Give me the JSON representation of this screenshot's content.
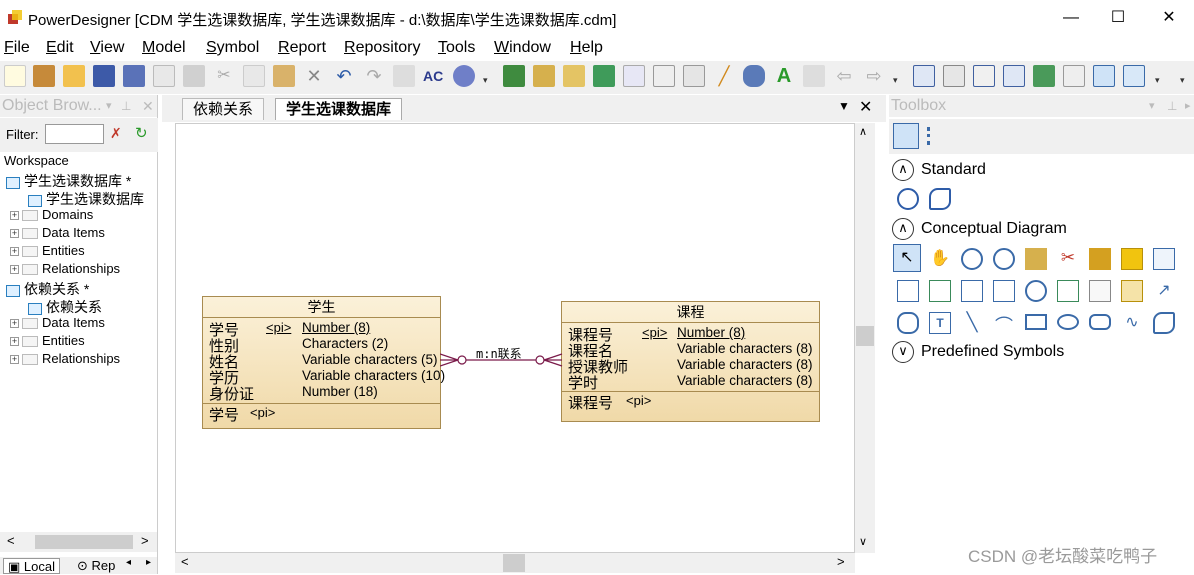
{
  "window": {
    "title": "PowerDesigner [CDM 学生选课数据库, 学生选课数据库 - d:\\数据库\\学生选课数据库.cdm]",
    "minimize": "—",
    "maximize": "☐",
    "close": "✕"
  },
  "menu": [
    {
      "key": "F",
      "rest": "ile"
    },
    {
      "key": "E",
      "rest": "dit"
    },
    {
      "key": "V",
      "rest": "iew"
    },
    {
      "key": "M",
      "rest": "odel"
    },
    {
      "key": "S",
      "rest": "ymbol"
    },
    {
      "key": "R",
      "rest": "eport"
    },
    {
      "key": "R",
      "rest": "epository"
    },
    {
      "key": "T",
      "rest": "ools"
    },
    {
      "key": "W",
      "rest": "indow"
    },
    {
      "key": "H",
      "rest": "elp"
    }
  ],
  "object_browser": {
    "title": "Object Brow...",
    "filter_label": "Filter:",
    "filter_value": "",
    "tree": {
      "root": "Workspace",
      "model1": "学生选课数据库 *",
      "model1_diagram": "学生选课数据库",
      "model1_domains": "Domains",
      "model1_data_items": "Data Items",
      "model1_entities": "Entities",
      "model1_relationships": "Relationships",
      "model2": "依赖关系 *",
      "model2_diagram": "依赖关系",
      "model2_data_items": "Data Items",
      "model2_entities": "Entities",
      "model2_relationships": "Relationships"
    },
    "bottom_tabs": [
      "Local",
      "Rep"
    ]
  },
  "diagram_tabs": [
    "依赖关系",
    "学生选课数据库"
  ],
  "diagram": {
    "entity_student": {
      "name": "学生",
      "attrs": [
        {
          "name": "学号",
          "pi": "<pi>",
          "type": "Number (8)"
        },
        {
          "name": "性别",
          "pi": "",
          "type": "Characters (2)"
        },
        {
          "name": "姓名",
          "pi": "",
          "type": "Variable characters (5)"
        },
        {
          "name": "学历",
          "pi": "",
          "type": "Variable characters (10)"
        },
        {
          "name": "身份证",
          "pi": "",
          "type": "Number (18)"
        }
      ],
      "identifier": {
        "name": "学号",
        "pi": "<pi>"
      }
    },
    "entity_course": {
      "name": "课程",
      "attrs": [
        {
          "name": "课程号",
          "pi": "<pi>",
          "type": "Number (8)"
        },
        {
          "name": "课程名",
          "pi": "",
          "type": "Variable characters (8)"
        },
        {
          "name": "授课教师",
          "pi": "",
          "type": "Variable characters (8)"
        },
        {
          "name": "学时",
          "pi": "",
          "type": "Variable characters (8)"
        }
      ],
      "identifier": {
        "name": "课程号",
        "pi": "<pi>"
      }
    },
    "relationship_label": "m:n联系"
  },
  "toolbox": {
    "title": "Toolbox",
    "sections": {
      "standard": "Standard",
      "conceptual": "Conceptual Diagram",
      "predefined": "Predefined Symbols"
    }
  },
  "watermark": "CSDN @老坛酸菜吃鸭子"
}
